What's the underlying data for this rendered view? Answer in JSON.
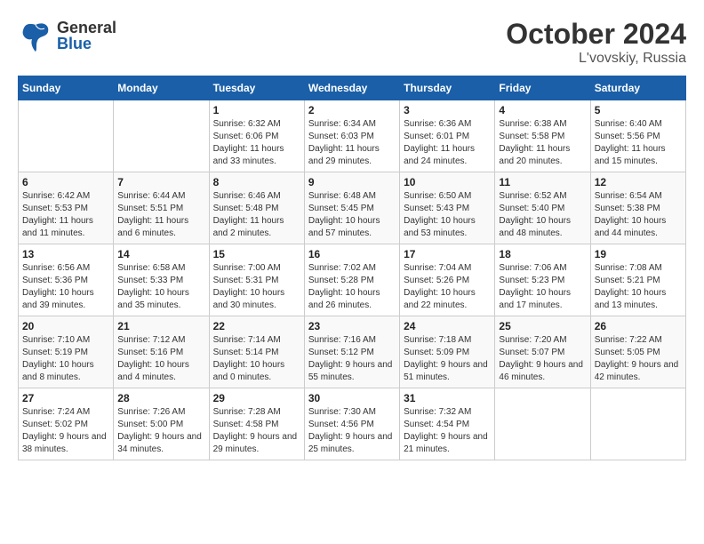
{
  "header": {
    "logo_general": "General",
    "logo_blue": "Blue",
    "month_title": "October 2024",
    "location": "L'vovskiy, Russia"
  },
  "weekdays": [
    "Sunday",
    "Monday",
    "Tuesday",
    "Wednesday",
    "Thursday",
    "Friday",
    "Saturday"
  ],
  "weeks": [
    [
      {
        "day": "",
        "info": ""
      },
      {
        "day": "",
        "info": ""
      },
      {
        "day": "1",
        "info": "Sunrise: 6:32 AM\nSunset: 6:06 PM\nDaylight: 11 hours and 33 minutes."
      },
      {
        "day": "2",
        "info": "Sunrise: 6:34 AM\nSunset: 6:03 PM\nDaylight: 11 hours and 29 minutes."
      },
      {
        "day": "3",
        "info": "Sunrise: 6:36 AM\nSunset: 6:01 PM\nDaylight: 11 hours and 24 minutes."
      },
      {
        "day": "4",
        "info": "Sunrise: 6:38 AM\nSunset: 5:58 PM\nDaylight: 11 hours and 20 minutes."
      },
      {
        "day": "5",
        "info": "Sunrise: 6:40 AM\nSunset: 5:56 PM\nDaylight: 11 hours and 15 minutes."
      }
    ],
    [
      {
        "day": "6",
        "info": "Sunrise: 6:42 AM\nSunset: 5:53 PM\nDaylight: 11 hours and 11 minutes."
      },
      {
        "day": "7",
        "info": "Sunrise: 6:44 AM\nSunset: 5:51 PM\nDaylight: 11 hours and 6 minutes."
      },
      {
        "day": "8",
        "info": "Sunrise: 6:46 AM\nSunset: 5:48 PM\nDaylight: 11 hours and 2 minutes."
      },
      {
        "day": "9",
        "info": "Sunrise: 6:48 AM\nSunset: 5:45 PM\nDaylight: 10 hours and 57 minutes."
      },
      {
        "day": "10",
        "info": "Sunrise: 6:50 AM\nSunset: 5:43 PM\nDaylight: 10 hours and 53 minutes."
      },
      {
        "day": "11",
        "info": "Sunrise: 6:52 AM\nSunset: 5:40 PM\nDaylight: 10 hours and 48 minutes."
      },
      {
        "day": "12",
        "info": "Sunrise: 6:54 AM\nSunset: 5:38 PM\nDaylight: 10 hours and 44 minutes."
      }
    ],
    [
      {
        "day": "13",
        "info": "Sunrise: 6:56 AM\nSunset: 5:36 PM\nDaylight: 10 hours and 39 minutes."
      },
      {
        "day": "14",
        "info": "Sunrise: 6:58 AM\nSunset: 5:33 PM\nDaylight: 10 hours and 35 minutes."
      },
      {
        "day": "15",
        "info": "Sunrise: 7:00 AM\nSunset: 5:31 PM\nDaylight: 10 hours and 30 minutes."
      },
      {
        "day": "16",
        "info": "Sunrise: 7:02 AM\nSunset: 5:28 PM\nDaylight: 10 hours and 26 minutes."
      },
      {
        "day": "17",
        "info": "Sunrise: 7:04 AM\nSunset: 5:26 PM\nDaylight: 10 hours and 22 minutes."
      },
      {
        "day": "18",
        "info": "Sunrise: 7:06 AM\nSunset: 5:23 PM\nDaylight: 10 hours and 17 minutes."
      },
      {
        "day": "19",
        "info": "Sunrise: 7:08 AM\nSunset: 5:21 PM\nDaylight: 10 hours and 13 minutes."
      }
    ],
    [
      {
        "day": "20",
        "info": "Sunrise: 7:10 AM\nSunset: 5:19 PM\nDaylight: 10 hours and 8 minutes."
      },
      {
        "day": "21",
        "info": "Sunrise: 7:12 AM\nSunset: 5:16 PM\nDaylight: 10 hours and 4 minutes."
      },
      {
        "day": "22",
        "info": "Sunrise: 7:14 AM\nSunset: 5:14 PM\nDaylight: 10 hours and 0 minutes."
      },
      {
        "day": "23",
        "info": "Sunrise: 7:16 AM\nSunset: 5:12 PM\nDaylight: 9 hours and 55 minutes."
      },
      {
        "day": "24",
        "info": "Sunrise: 7:18 AM\nSunset: 5:09 PM\nDaylight: 9 hours and 51 minutes."
      },
      {
        "day": "25",
        "info": "Sunrise: 7:20 AM\nSunset: 5:07 PM\nDaylight: 9 hours and 46 minutes."
      },
      {
        "day": "26",
        "info": "Sunrise: 7:22 AM\nSunset: 5:05 PM\nDaylight: 9 hours and 42 minutes."
      }
    ],
    [
      {
        "day": "27",
        "info": "Sunrise: 7:24 AM\nSunset: 5:02 PM\nDaylight: 9 hours and 38 minutes."
      },
      {
        "day": "28",
        "info": "Sunrise: 7:26 AM\nSunset: 5:00 PM\nDaylight: 9 hours and 34 minutes."
      },
      {
        "day": "29",
        "info": "Sunrise: 7:28 AM\nSunset: 4:58 PM\nDaylight: 9 hours and 29 minutes."
      },
      {
        "day": "30",
        "info": "Sunrise: 7:30 AM\nSunset: 4:56 PM\nDaylight: 9 hours and 25 minutes."
      },
      {
        "day": "31",
        "info": "Sunrise: 7:32 AM\nSunset: 4:54 PM\nDaylight: 9 hours and 21 minutes."
      },
      {
        "day": "",
        "info": ""
      },
      {
        "day": "",
        "info": ""
      }
    ]
  ]
}
